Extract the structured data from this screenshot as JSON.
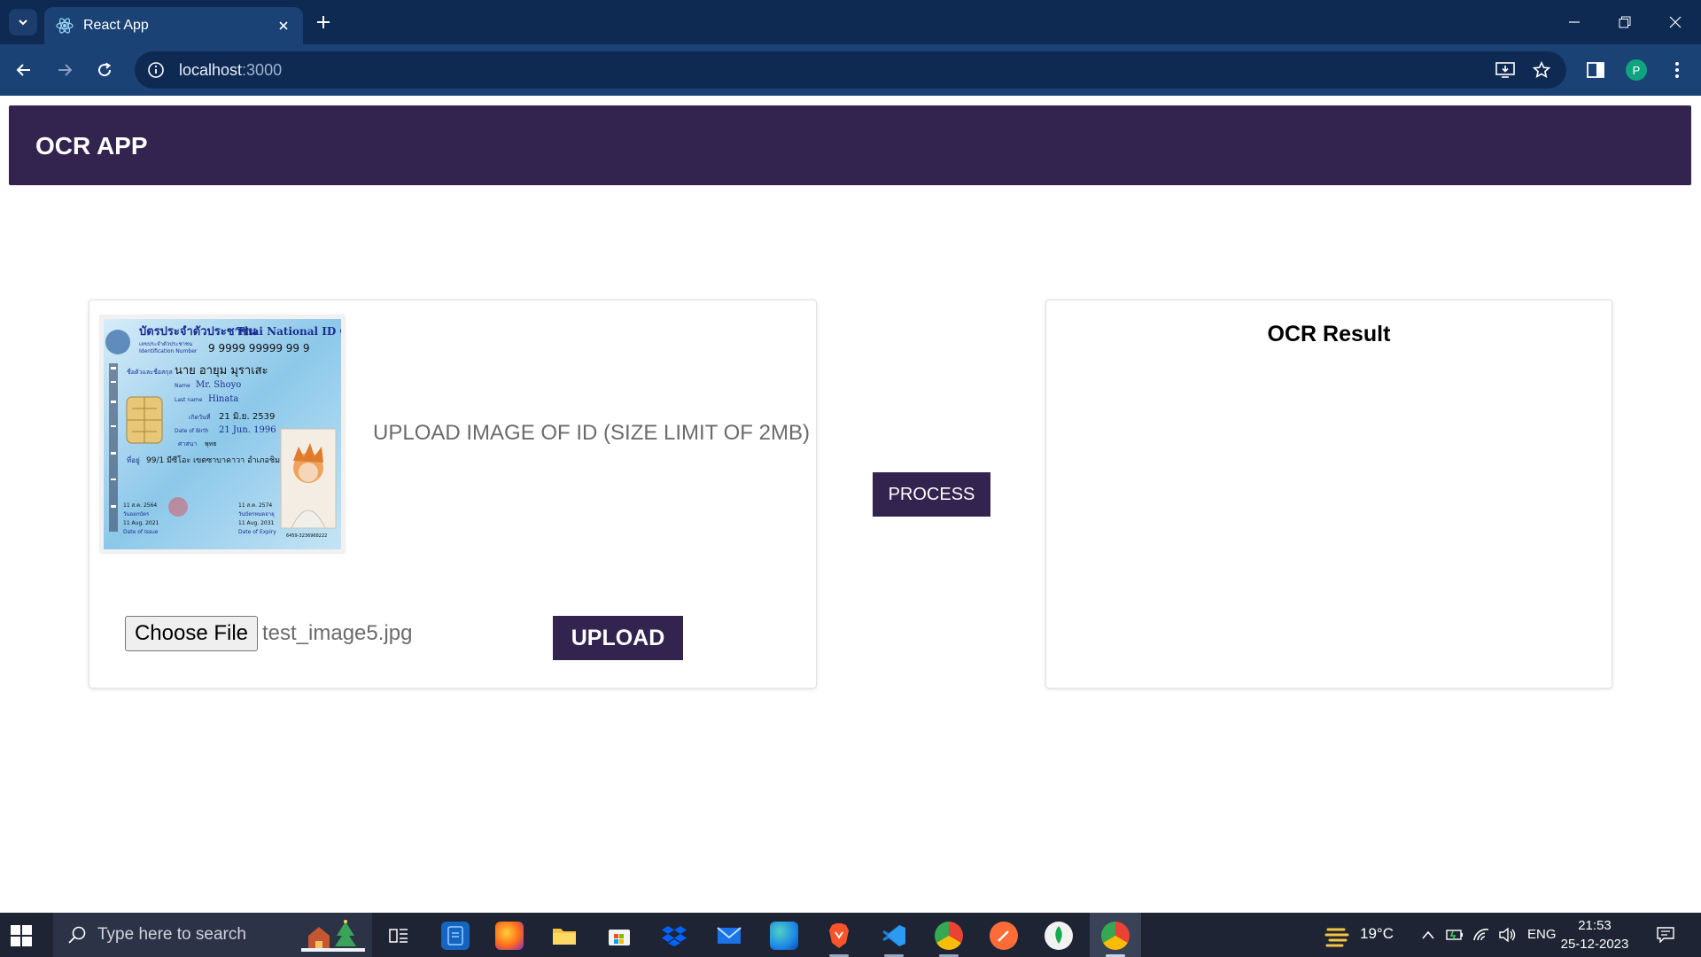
{
  "browser": {
    "tab_title": "React App",
    "url_host": "localhost",
    "url_port": ":3000",
    "profile_initial": "P"
  },
  "app": {
    "title": "OCR APP",
    "upload_hint": "UPLOAD IMAGE OF ID (SIZE LIMIT OF 2MB)",
    "choose_file_label": "Choose File",
    "selected_file": "test_image5.jpg",
    "upload_label": "UPLOAD",
    "process_label": "PROCESS",
    "result_title": "OCR Result",
    "preview": {
      "card_title_th": "บัตรประจำตัวประชาชน",
      "card_title_en": "Thai National ID Card",
      "id_label_th": "เลขประจำตัวประชาชน",
      "id_label_en": "Identification Number",
      "id_number": "9 9999 99999 99 9",
      "name_label_th": "ชื่อตัวและชื่อสกุล",
      "name_th": "นาย อายุม มุราเสะ",
      "name_label_en": "Name",
      "name_en": "Mr. Shoyo",
      "last_name_label_en": "Last name",
      "last_name_en": "Hinata",
      "dob_label_th": "เกิดวันที่",
      "dob_th": "21 มิ.ย. 2539",
      "dob_label_en": "Date of Birth",
      "dob_en": "21 Jun. 1996",
      "religion_label_th": "ศาสนา",
      "religion_th": "พุทธ",
      "address_label_th": "ที่อยู่",
      "address_th": "99/1 มีซีโอะ เขตซาบาคาวา อำเภอชิมะ",
      "issue_date_th": "11 ส.ค. 2564",
      "issue_label_th": "วันออกบัตร",
      "issue_date_en": "11 Aug. 2021",
      "issue_label_en": "Date of Issue",
      "expiry_date_th": "11 ส.ค. 2574",
      "expiry_label_th": "วันบัตรหมดอายุ",
      "expiry_date_en": "11 Aug. 2031",
      "expiry_label_en": "Date of Expiry",
      "serial": "6459-3236968222"
    }
  },
  "taskbar": {
    "search_placeholder": "Type here to search",
    "weather": "19°C",
    "language": "ENG",
    "time": "21:53",
    "date": "25-12-2023"
  },
  "colors": {
    "brand": "#32244f",
    "chrome_dark": "#0e2a52",
    "chrome_toolbar": "#1a4275",
    "taskbar": "#1e2433"
  }
}
